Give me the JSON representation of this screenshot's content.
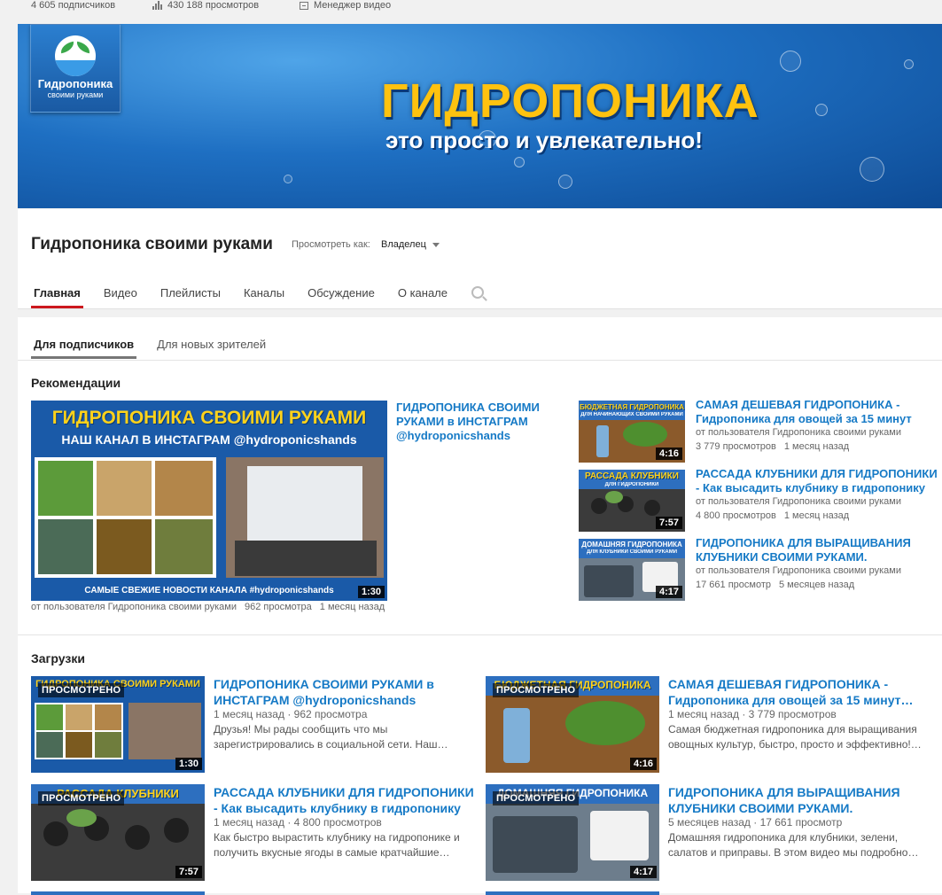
{
  "stats": {
    "subscribers": "4 605 подписчиков",
    "views": "430 188 просмотров",
    "video_manager": "Менеджер видео"
  },
  "banner": {
    "logo_line1": "Гидропоника",
    "logo_line2": "своими руками",
    "title": "ГИДРОПОНИКА",
    "subtitle": "это просто и увлекательно!"
  },
  "channel": {
    "name": "Гидропоника своими руками",
    "view_as_label": "Просмотреть как:",
    "view_as_value": "Владелец",
    "tabs": [
      "Главная",
      "Видео",
      "Плейлисты",
      "Каналы",
      "Обсуждение",
      "О канале"
    ]
  },
  "subtabs": [
    "Для подписчиков",
    "Для новых зрителей"
  ],
  "recommendations": {
    "title": "Рекомендации",
    "featured": {
      "title": "ГИДРОПОНИКА СВОИМИ РУКАМИ в ИНСТАГРАМ @hydroponicshands",
      "thumb_top": "ГИДРОПОНИКА СВОИМИ РУКАМИ",
      "thumb_sub": "НАШ КАНАЛ В ИНСТАГРАМ @hydroponicshands",
      "thumb_bottom": "САМЫЕ СВЕЖИЕ НОВОСТИ КАНАЛА #hydroponicshands",
      "duration": "1:30",
      "author": "от пользователя Гидропоника своими руками",
      "views": "962 просмотра",
      "age": "1 месяц назад"
    },
    "side": [
      {
        "title": "САМАЯ ДЕШЕВАЯ ГИДРОПОНИКА - Гидропоника для овощей за 15 минут",
        "thumb_top": "БЮДЖЕТНАЯ ГИДРОПОНИКА",
        "thumb_sub": "ДЛЯ НАЧИНАЮЩИХ СВОИМИ РУКАМИ",
        "duration": "4:16",
        "author": "от пользователя Гидропоника своими руками",
        "views": "3 779 просмотров",
        "age": "1 месяц назад"
      },
      {
        "title": "РАССАДА КЛУБНИКИ ДЛЯ ГИДРОПОНИКИ - Как высадить клубнику в гидропонику",
        "thumb_top": "РАССАДА КЛУБНИКИ",
        "thumb_sub": "ДЛЯ ГИДРОПОНИКИ",
        "duration": "7:57",
        "author": "от пользователя Гидропоника своими руками",
        "views": "4 800 просмотров",
        "age": "1 месяц назад"
      },
      {
        "title": "ГИДРОПОНИКА ДЛЯ ВЫРАЩИВАНИЯ КЛУБНИКИ СВОИМИ РУКАМИ.",
        "thumb_top": "ДОМАШНЯЯ ГИДРОПОНИКА",
        "thumb_sub": "ДЛЯ КЛУБНИКИ СВОИМИ РУКАМИ",
        "duration": "4:17",
        "author": "от пользователя Гидропоника своими руками",
        "views": "17 661 просмотр",
        "age": "5 месяцев назад"
      }
    ]
  },
  "uploads": {
    "title": "Загрузки",
    "watched_label": "ПРОСМОТРЕНО",
    "items": [
      {
        "title": "ГИДРОПОНИКА СВОИМИ РУКАМИ в ИНСТАГРАМ @hydroponicshands",
        "age": "1 месяц назад",
        "views": "962 просмотра",
        "desc": "Друзья! Мы рады сообщить что мы зарегистрировались в социальной сети. Наш…",
        "thumb_top": "ГИДРОПОНИКА СВОИМИ РУКАМИ",
        "duration": "1:30"
      },
      {
        "title": "САМАЯ ДЕШЕВАЯ ГИДРОПОНИКА - Гидропоника для овощей за 15 минут…",
        "age": "1 месяц назад",
        "views": "3 779 просмотров",
        "desc": "Самая бюджетная гидропоника для выращивания овощных культур, быстро, просто и эффективно!…",
        "thumb_top": "БЮДЖЕТНАЯ ГИДРОПОНИКА",
        "duration": "4:16"
      },
      {
        "title": "РАССАДА КЛУБНИКИ ДЛЯ ГИДРОПОНИКИ - Как высадить клубнику в гидропонику",
        "age": "1 месяц назад",
        "views": "4 800 просмотров",
        "desc": "Как быстро вырастить клубнику на гидропонике и получить вкусные ягоды в самые кратчайшие…",
        "thumb_top": "РАССАДА КЛУБНИКИ",
        "duration": "7:57"
      },
      {
        "title": "ГИДРОПОНИКА ДЛЯ ВЫРАЩИВАНИЯ КЛУБНИКИ СВОИМИ РУКАМИ.",
        "age": "5 месяцев назад",
        "views": "17 661 просмотр",
        "desc": "Домашняя гидропоника для клубники, зелени, салатов и приправы. В этом видео мы подробно…",
        "thumb_top": "ДОМАШНЯЯ ГИДРОПОНИКА",
        "duration": "4:17"
      }
    ]
  },
  "colors": {
    "link": "#167ac6",
    "accent_red": "#cc181e",
    "banner_yellow": "#ffc20f"
  }
}
